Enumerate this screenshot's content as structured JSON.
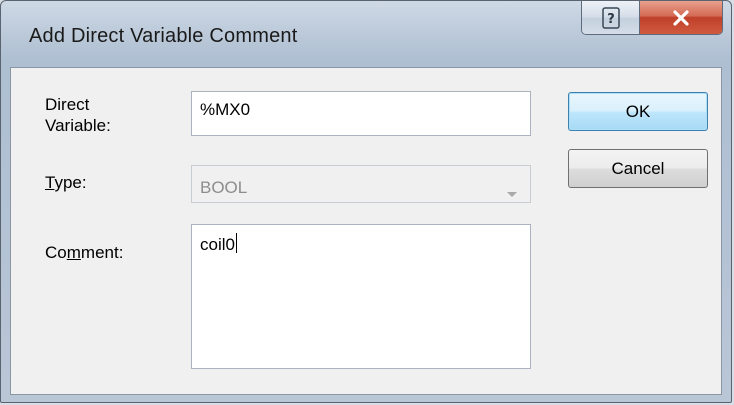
{
  "window": {
    "title": "Add Direct Variable Comment",
    "help_glyph": "?",
    "close_glyph": "X"
  },
  "form": {
    "direct_variable": {
      "label_line1": "Direct",
      "label_line2": "Variable:",
      "value": "%MX0"
    },
    "type": {
      "label_mnemonic": "T",
      "label_rest": "ype:",
      "value": "BOOL",
      "enabled": false
    },
    "comment": {
      "label_pre": "Co",
      "label_mnemonic": "m",
      "label_post": "ment:",
      "value": "coil0"
    }
  },
  "buttons": {
    "ok_label": "OK",
    "cancel_label": "Cancel"
  },
  "icons": {
    "help": "help-icon",
    "close": "close-icon",
    "dropdown": "chevron-down-icon"
  }
}
